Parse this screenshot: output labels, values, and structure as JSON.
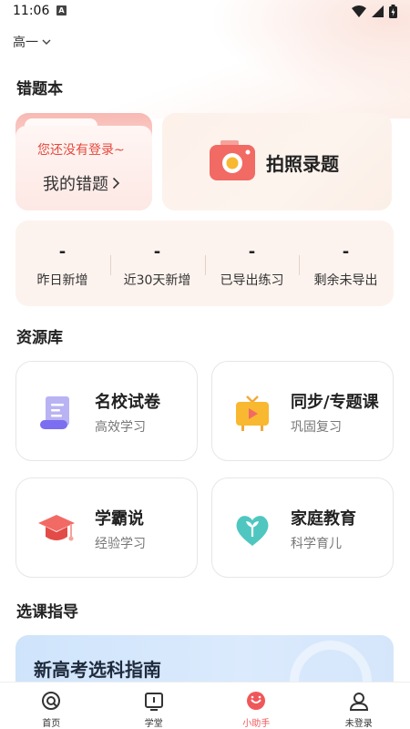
{
  "status_bar": {
    "time": "11:06",
    "notif_badge": "A"
  },
  "grade_selector": {
    "label": "高一"
  },
  "wrong_book": {
    "section_title": "错题本",
    "login_hint": "您还没有登录~",
    "my_wrong_label": "我的错题",
    "photo_label": "拍照录题",
    "stats": [
      {
        "value": "-",
        "label": "昨日新增"
      },
      {
        "value": "-",
        "label": "近30天新增"
      },
      {
        "value": "-",
        "label": "已导出练习"
      },
      {
        "value": "-",
        "label": "剩余未导出"
      }
    ]
  },
  "resources": {
    "section_title": "资源库",
    "items": [
      {
        "title": "名校试卷",
        "subtitle": "高效学习",
        "icon": "scroll-icon"
      },
      {
        "title": "同步/专题课",
        "subtitle": "巩固复习",
        "icon": "video-board-icon"
      },
      {
        "title": "学霸说",
        "subtitle": "经验学习",
        "icon": "graduation-cap-icon"
      },
      {
        "title": "家庭教育",
        "subtitle": "科学育儿",
        "icon": "heart-sprout-icon"
      }
    ]
  },
  "course_guide": {
    "section_title": "选课指导",
    "banner_title": "新高考选科指南"
  },
  "bottom_nav": {
    "items": [
      {
        "label": "首页",
        "icon": "home-icon"
      },
      {
        "label": "学堂",
        "icon": "school-icon"
      },
      {
        "label": "小助手",
        "icon": "assistant-icon"
      },
      {
        "label": "未登录",
        "icon": "user-icon"
      }
    ],
    "active_index": 2
  },
  "colors": {
    "accent": "#f0575a",
    "hint_red": "#e4493d"
  }
}
